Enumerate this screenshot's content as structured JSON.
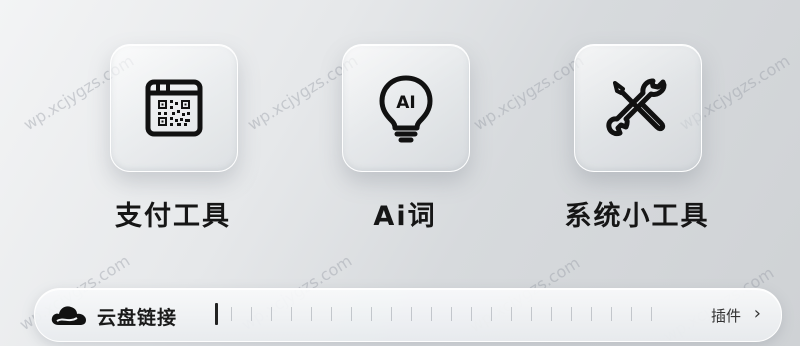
{
  "tools": [
    {
      "label": "支付工具",
      "icon": "qr-code-icon"
    },
    {
      "label": "Ai词",
      "icon": "ai-lightbulb-icon",
      "icon_text": "AI"
    },
    {
      "label": "系统小工具",
      "icon": "wrench-screwdriver-icon"
    }
  ],
  "bottom_bar": {
    "title": "云盘链接",
    "icon": "cloud-icon",
    "plugin_label": "插件",
    "chevron": "›"
  },
  "watermark": "wp.xcjygzs.com"
}
